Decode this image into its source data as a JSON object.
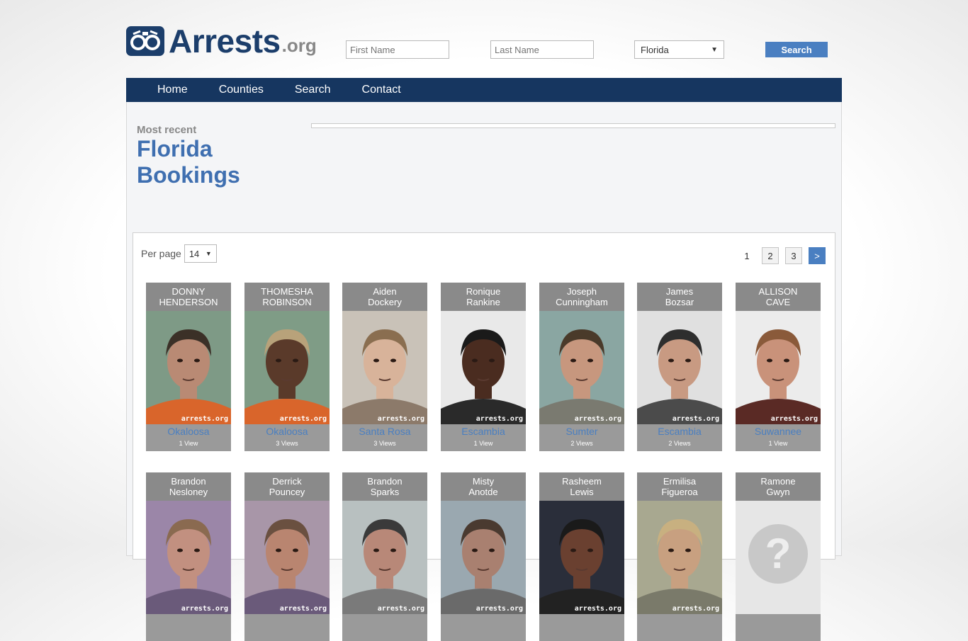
{
  "logo": {
    "main": "Arrests",
    "ext": ".org"
  },
  "search": {
    "first_placeholder": "First Name",
    "last_placeholder": "Last Name",
    "state": "Florida",
    "button": "Search"
  },
  "nav": [
    "Home",
    "Counties",
    "Search",
    "Contact"
  ],
  "page": {
    "kicker": "Most recent",
    "title_line1": "Florida",
    "title_line2": "Bookings"
  },
  "list": {
    "per_page_label": "Per page",
    "per_page_value": "14",
    "pages": [
      "1",
      "2",
      "3",
      ">"
    ]
  },
  "bookings": [
    {
      "first": "DONNY",
      "last": "HENDERSON",
      "county": "Okaloosa",
      "views": "1 View",
      "bg": "#7e9a86",
      "shirt": "#d9652b",
      "skin": "#b98a74",
      "hair": "#3b3027"
    },
    {
      "first": "THOMESHA",
      "last": "ROBINSON",
      "county": "Okaloosa",
      "views": "3 Views",
      "bg": "#7f9c86",
      "shirt": "#d9652b",
      "skin": "#5a3a2a",
      "hair": "#b8a27a"
    },
    {
      "first": "Aiden",
      "last": "Dockery",
      "county": "Santa Rosa",
      "views": "3 Views",
      "bg": "#c9c2b8",
      "shirt": "#8c7a6a",
      "skin": "#d8b39a",
      "hair": "#8a6e50"
    },
    {
      "first": "Ronique",
      "last": "Rankine",
      "county": "Escambia",
      "views": "1 View",
      "bg": "#e9e9e9",
      "shirt": "#2a2a2a",
      "skin": "#4a2c20",
      "hair": "#1a1a1a"
    },
    {
      "first": "Joseph",
      "last": "Cunningham",
      "county": "Sumter",
      "views": "2 Views",
      "bg": "#8aa6a2",
      "shirt": "#7a7a70",
      "skin": "#c7977e",
      "hair": "#4a3a2a"
    },
    {
      "first": "James",
      "last": "Bozsar",
      "county": "Escambia",
      "views": "2 Views",
      "bg": "#e0e0e0",
      "shirt": "#4b4b4b",
      "skin": "#c89a82",
      "hair": "#2e2e2e"
    },
    {
      "first": "ALLISON",
      "last": "CAVE",
      "county": "Suwannee",
      "views": "1 View",
      "bg": "#ececec",
      "shirt": "#5a2a25",
      "skin": "#c9927a",
      "hair": "#8a5a3a"
    },
    {
      "first": "Brandon",
      "last": "Nesloney",
      "county": "",
      "views": "",
      "bg": "#9b86a8",
      "shirt": "#6a5a7a",
      "skin": "#c29080",
      "hair": "#8a6a50"
    },
    {
      "first": "Derrick",
      "last": "Pouncey",
      "county": "",
      "views": "",
      "bg": "#a896a8",
      "shirt": "#6a5a7a",
      "skin": "#b98570",
      "hair": "#6a5040"
    },
    {
      "first": "Brandon",
      "last": "Sparks",
      "county": "",
      "views": "",
      "bg": "#b8c0c0",
      "shirt": "#7a7a7a",
      "skin": "#b88878",
      "hair": "#3a3a3a"
    },
    {
      "first": "Misty",
      "last": "Anotde",
      "county": "",
      "views": "",
      "bg": "#9aa8b0",
      "shirt": "#6a6a6a",
      "skin": "#a98070",
      "hair": "#4a3a30"
    },
    {
      "first": "Rasheem",
      "last": "Lewis",
      "county": "",
      "views": "",
      "bg": "#2a2e3a",
      "shirt": "#222",
      "skin": "#6a4030",
      "hair": "#1a1a1a"
    },
    {
      "first": "Ermilisa",
      "last": "Figueroa",
      "county": "",
      "views": "",
      "bg": "#a8a890",
      "shirt": "#7a7a6a",
      "skin": "#c8a080",
      "hair": "#c8b080"
    },
    {
      "first": "Ramone",
      "last": "Gwyn",
      "county": "",
      "views": "",
      "bg": "#e6e6e6",
      "shirt": "#e6e6e6",
      "skin": "#9a9a9a",
      "hair": "#9a9a9a",
      "placeholder": true
    }
  ],
  "watermark": "arrests.org"
}
